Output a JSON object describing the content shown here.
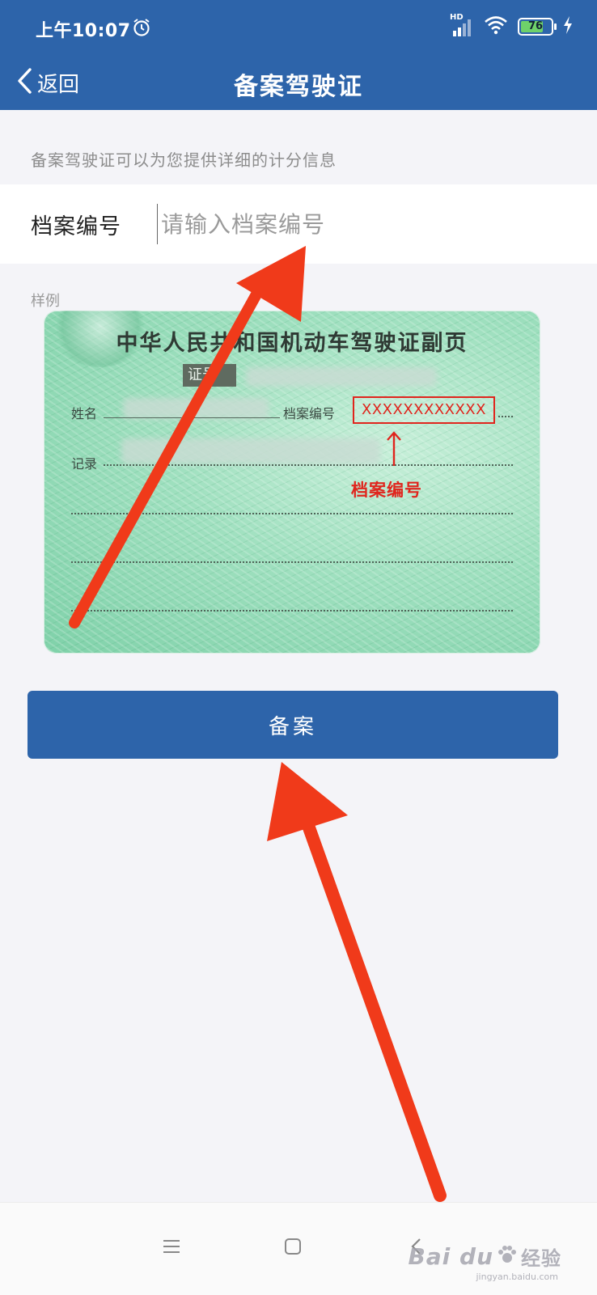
{
  "status_bar": {
    "time": "上午10:07",
    "network_badge": "HD",
    "battery": "76",
    "battery_level_percent": 76
  },
  "nav": {
    "back_label": "返回",
    "title": "备案驾驶证"
  },
  "hint": "备案驾驶证可以为您提供详细的计分信息",
  "form": {
    "field_label": "档案编号",
    "field_value": "",
    "field_placeholder": "请输入档案编号"
  },
  "sample": {
    "label": "样例",
    "card_title": "中华人民共和国机动车驾驶证副页",
    "card_id_label": "证号",
    "name_label": "姓名",
    "file_no_label": "档案编号",
    "record_label": "记录",
    "file_no_example": "XXXXXXXXXXXX",
    "annotation": "档案编号"
  },
  "button": {
    "submit_label": "备案"
  },
  "watermark": {
    "brand": "Bai du",
    "suffix": "经验",
    "sub": "jingyan.baidu.com"
  },
  "colors": {
    "primary": "#2d64aa",
    "annotation_red": "#e0251d",
    "arrow_red": "#f03a1a"
  }
}
